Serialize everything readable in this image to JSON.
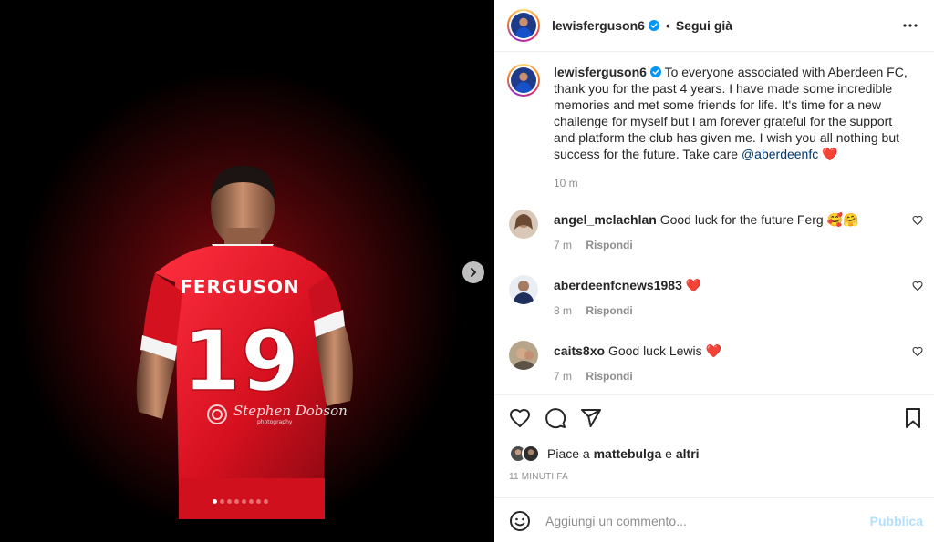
{
  "post": {
    "username": "lewisferguson6",
    "separator": "•",
    "follow_label": "Segui già",
    "caption_text": "To everyone associated with Aberdeen FC, thank you for the past 4 years. I have made some incredible memories and met some friends for life. It's time for a new challenge for myself but I am forever grateful for the support and platform the club has given me. I wish you all nothing but success for the future. Take care",
    "caption_mention": "@aberdeenfc",
    "caption_emoji": "❤️",
    "caption_time": "10 m"
  },
  "media": {
    "shirt_name": "FERGUSON",
    "shirt_number": "19",
    "watermark": "Stephen Dobson",
    "watermark_sub": "photography",
    "slide_count": 8,
    "active_slide": 1
  },
  "comments": [
    {
      "username": "angel_mclachlan",
      "text": "Good luck for the future Ferg",
      "emoji": "🥰🤗",
      "time": "7 m",
      "reply_label": "Rispondi"
    },
    {
      "username": "aberdeenfcnews1983",
      "text": "",
      "emoji": "❤️",
      "time": "8 m",
      "reply_label": "Rispondi"
    },
    {
      "username": "caits8xo",
      "text": "Good luck Lewis",
      "emoji": "❤️",
      "time": "7 m",
      "reply_label": "Rispondi"
    }
  ],
  "likes": {
    "prefix": "Piace a",
    "user": "mattebulga",
    "conjunction": "e",
    "others": "altri"
  },
  "timestamp": "11 MINUTI FA",
  "comment_box": {
    "placeholder": "Aggiungi un commento...",
    "publish_label": "Pubblica"
  },
  "colors": {
    "verified": "#0095f6",
    "mention": "#00376b",
    "publish_disabled": "#b2dffc",
    "heart": "#ed4956",
    "jersey_red": "#e3152d"
  }
}
